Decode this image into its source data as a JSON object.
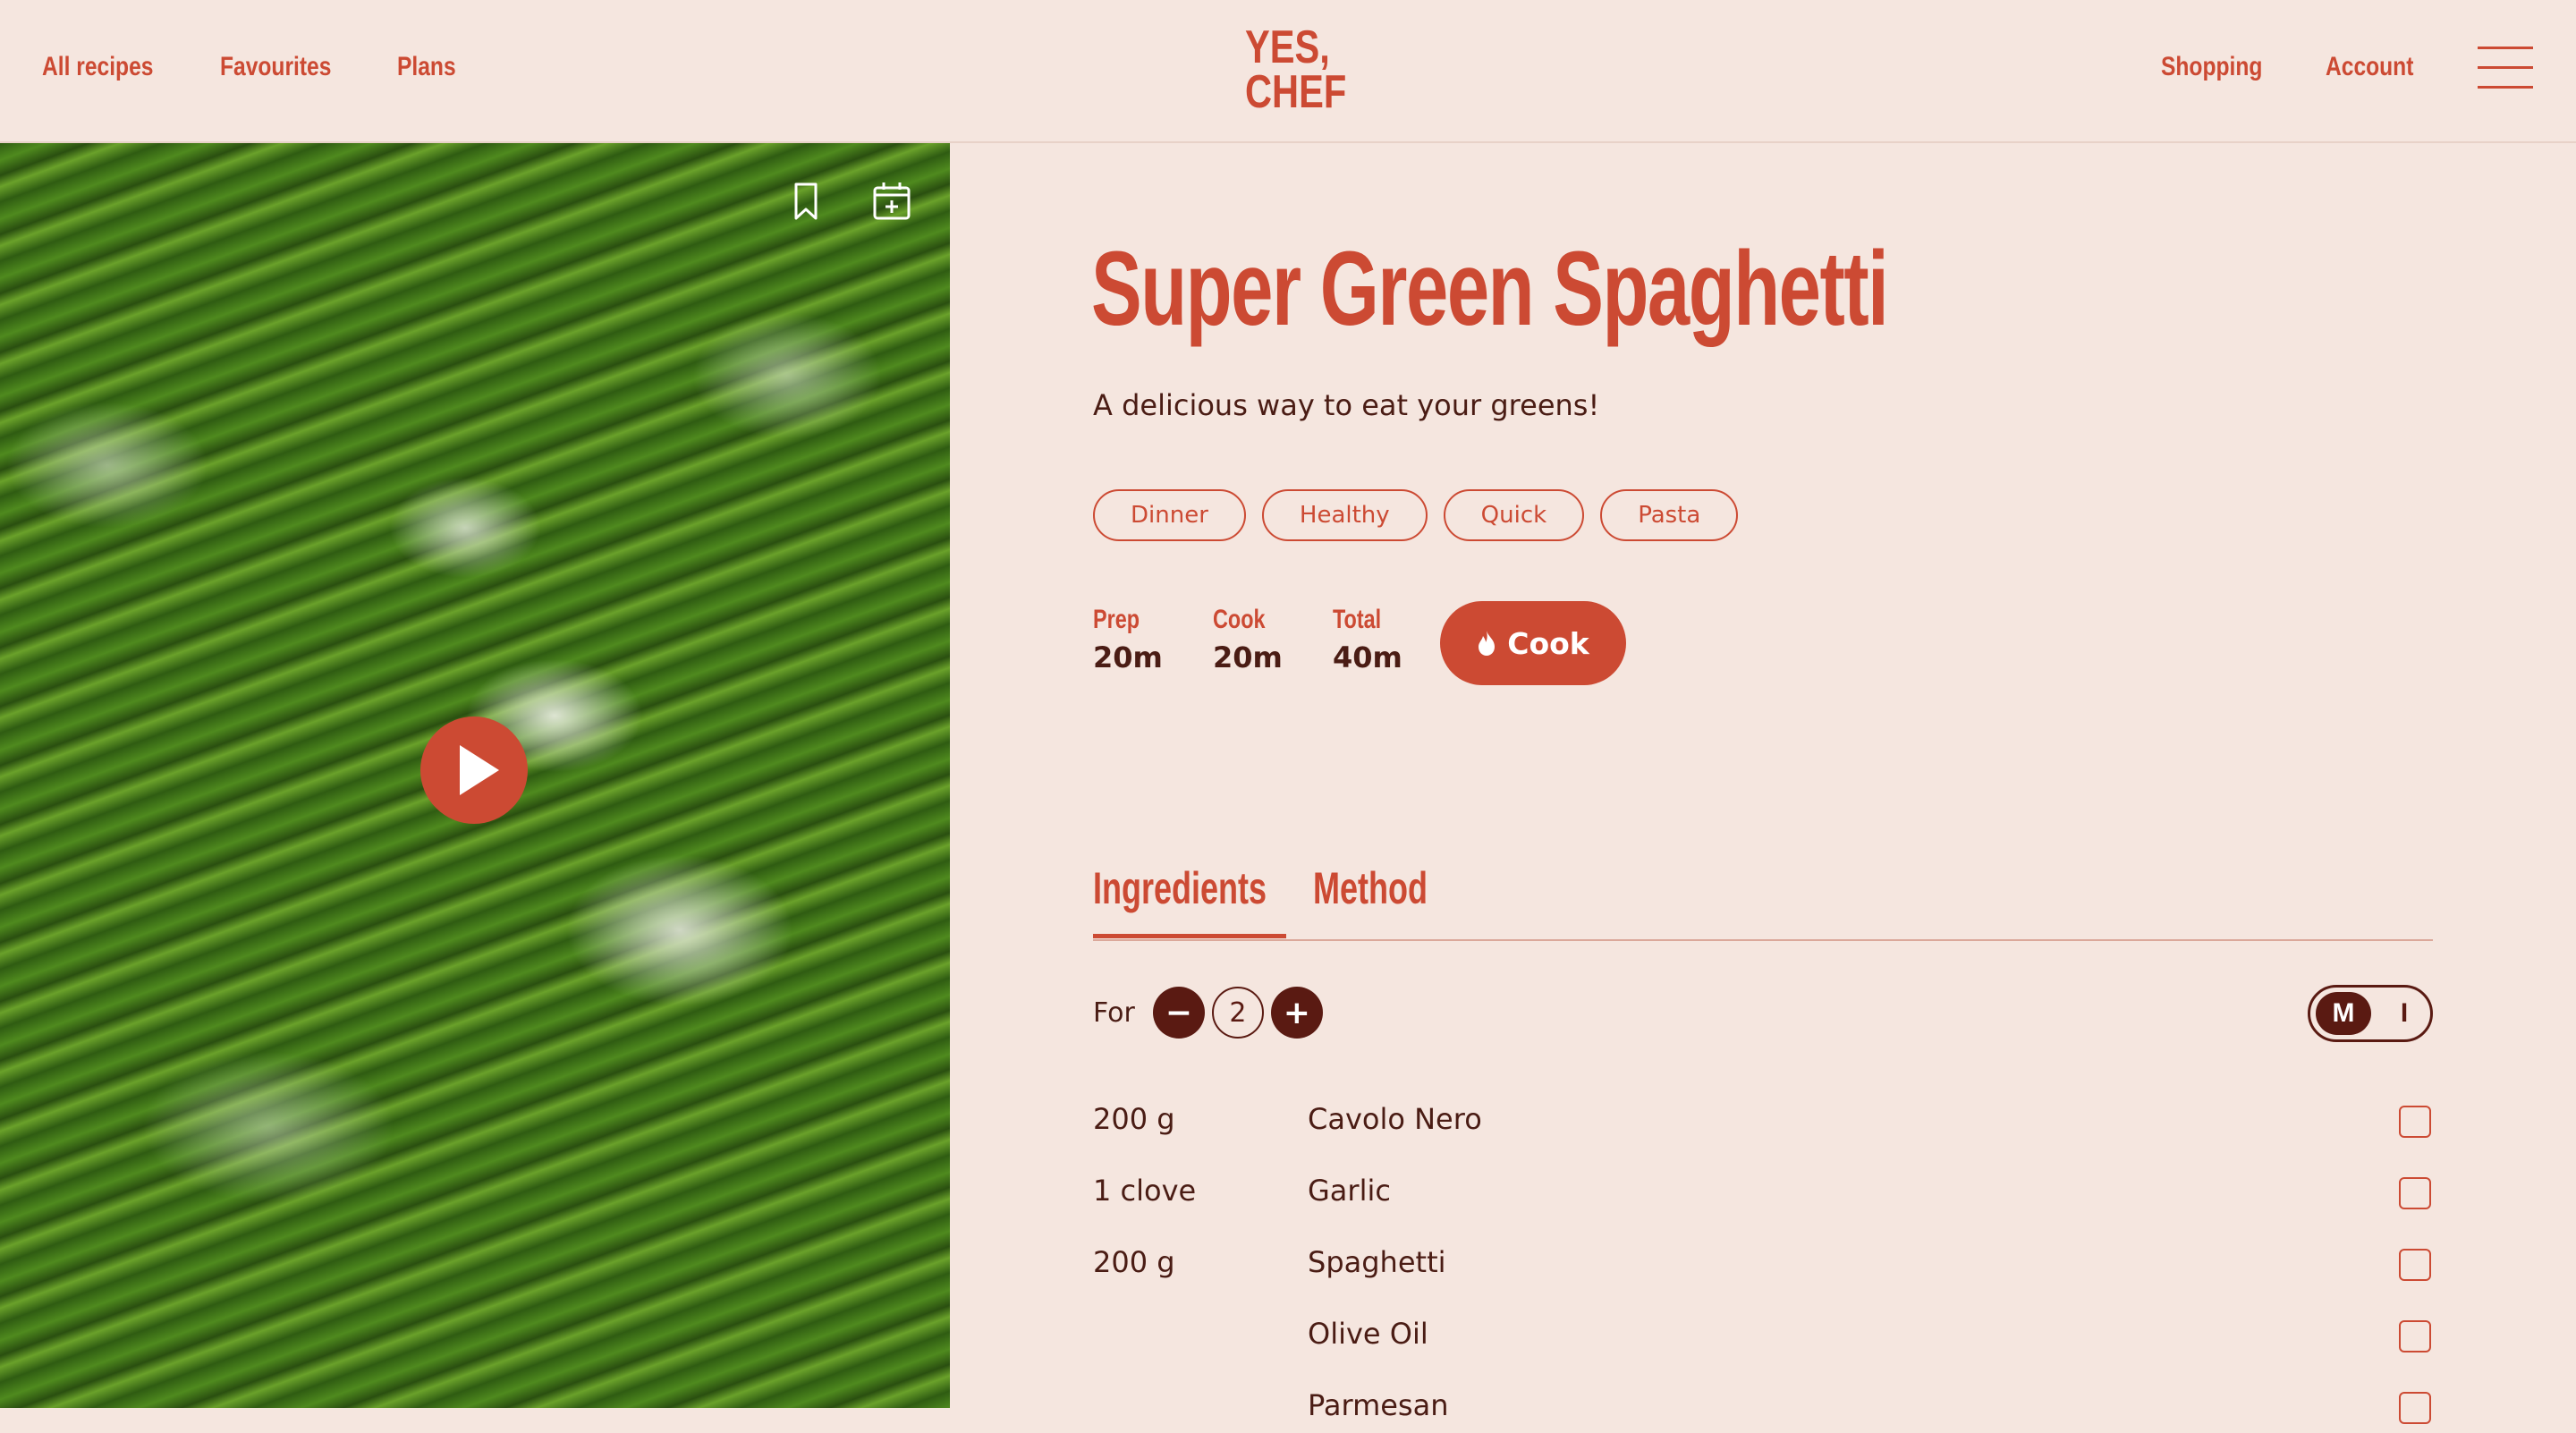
{
  "nav": {
    "left": [
      "All recipes",
      "Favourites",
      "Plans"
    ],
    "logo_line1": "YES,",
    "logo_line2": "CHEF",
    "right": [
      "Shopping",
      "Account"
    ]
  },
  "hero": {
    "bookmark_icon": "bookmark-icon",
    "calendar_icon": "calendar-add-icon",
    "play_icon": "play-icon"
  },
  "recipe": {
    "title": "Super Green Spaghetti",
    "description": "A delicious way to eat your greens!",
    "tags": [
      "Dinner",
      "Healthy",
      "Quick",
      "Pasta"
    ],
    "times": [
      {
        "label": "Prep",
        "value": "20m"
      },
      {
        "label": "Cook",
        "value": "20m"
      },
      {
        "label": "Total",
        "value": "40m"
      }
    ],
    "cook_button": "Cook"
  },
  "tabs": [
    "Ingredients",
    "Method"
  ],
  "servings": {
    "label": "For",
    "count": "2",
    "minus": "−",
    "plus": "+"
  },
  "units": {
    "metric": "M",
    "imperial": "I"
  },
  "ingredients": [
    {
      "qty": "200 g",
      "name": "Cavolo Nero"
    },
    {
      "qty": "1 clove",
      "name": "Garlic"
    },
    {
      "qty": "200 g",
      "name": "Spaghetti"
    },
    {
      "qty": "",
      "name": "Olive Oil"
    },
    {
      "qty": "",
      "name": "Parmesan"
    }
  ],
  "colors": {
    "accent": "#cc4a33",
    "background": "#f5e6df",
    "text": "#4a1c14",
    "dark": "#5a1a12"
  }
}
